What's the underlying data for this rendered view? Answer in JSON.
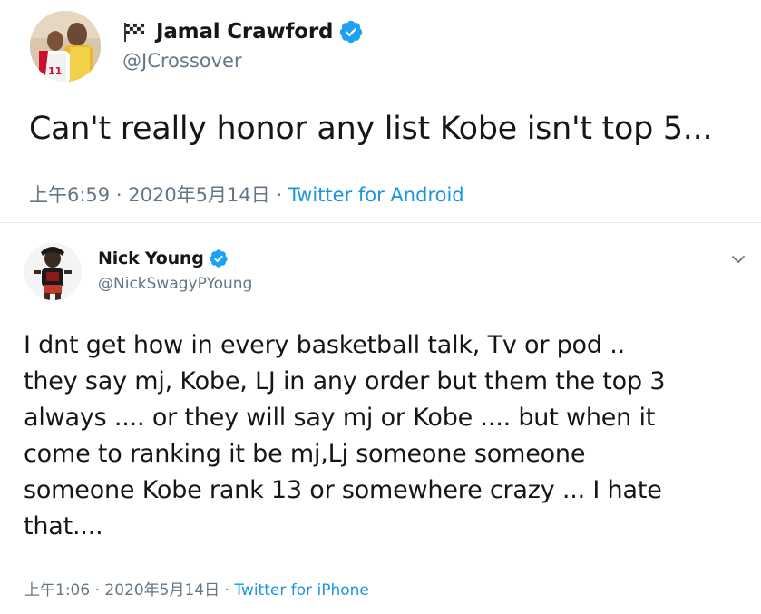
{
  "tweets": [
    {
      "name": "Jamal Crawford",
      "handle": "@JCrossover",
      "verified": true,
      "name_emoji_icon": "checkered-flag-icon",
      "text": "Can't really honor any list Kobe isn't top 5...",
      "time": "上午6:59",
      "date": "2020年5月14日",
      "source": "Twitter for Android"
    },
    {
      "name": "Nick Young",
      "handle": "@NickSwagyPYoung",
      "verified": true,
      "text_lines": [
        "I dnt get how in every basketball talk, Tv or pod ..",
        "they say mj, Kobe, LJ in any order but them the top 3",
        "always .... or they will say mj or Kobe .... but when it",
        "come to ranking it be mj,Lj someone someone",
        "someone Kobe rank 13 or somewhere crazy ... I hate",
        "that...."
      ],
      "time": "上午1:06",
      "date": "2020年5月14日",
      "source": "Twitter for iPhone"
    }
  ],
  "separator": "·",
  "colors": {
    "text": "#14171a",
    "secondary": "#657786",
    "link": "#1b95e0",
    "verified": "#1da1f2",
    "divider": "#e1e8ed"
  }
}
